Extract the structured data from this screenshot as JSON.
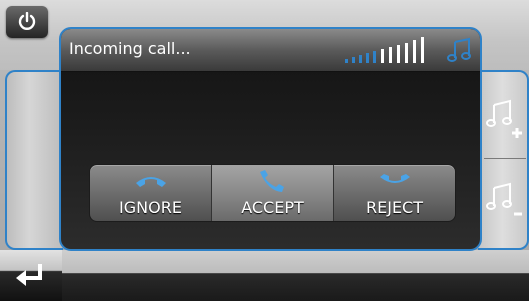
{
  "dialog": {
    "title": "Incoming call..."
  },
  "buttons": {
    "ignore": "IGNORE",
    "accept": "ACCEPT",
    "reject": "REJECT"
  },
  "icons": {
    "power": "power-icon",
    "signal": "signal-strength-icon",
    "music": "music-note-icon",
    "volume_up": "volume-up-icon",
    "volume_down": "volume-down-icon",
    "back": "back-enter-icon"
  },
  "colors": {
    "accent": "#2f82c8",
    "accept_phone": "#4aa3e6"
  }
}
